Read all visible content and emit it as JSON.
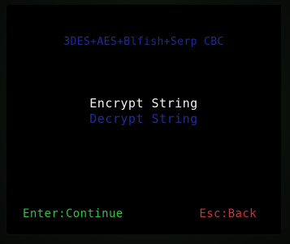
{
  "header": {
    "title": "3DES+AES+Blfish+Serp CBC"
  },
  "menu": {
    "items": [
      {
        "label": "Encrypt String",
        "selected": true
      },
      {
        "label": "Decrypt String",
        "selected": false
      }
    ]
  },
  "footer": {
    "left_hint": "Enter:Continue",
    "right_hint": "Esc:Back"
  },
  "colors": {
    "background": "#000000",
    "title": "#1e2a9a",
    "selected_item": "#f2f2f2",
    "unselected_item": "#1f2a9c",
    "left_hint": "#2cc23a",
    "right_hint": "#c8323a"
  }
}
